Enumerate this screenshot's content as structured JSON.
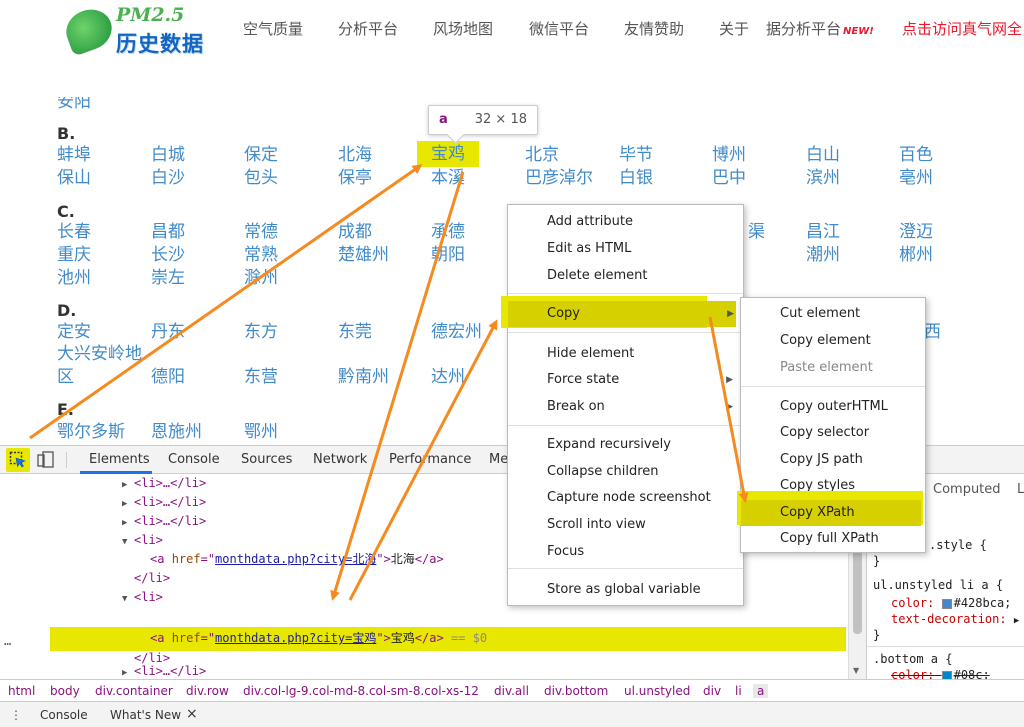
{
  "site": {
    "logo_top": "PM2.5",
    "logo_bottom": "历史数据",
    "nav": [
      "空气质量",
      "分析平台",
      "风场地图",
      "微信平台",
      "友情赞助",
      "关于"
    ],
    "nav_highlight_1": "据分析平台",
    "nav_new_badge": "NEW!",
    "nav_highlight_2": "点击访问真气网全"
  },
  "cities": {
    "partial_top": "安阳",
    "B": {
      "letter": "B.",
      "row1": [
        "蚌埠",
        "白城",
        "保定",
        "北海",
        "宝鸡",
        "北京",
        "毕节",
        "博州",
        "白山",
        "百色"
      ],
      "row2": [
        "保山",
        "白沙",
        "包头",
        "保亭",
        "本溪",
        "巴彦淖尔",
        "白银",
        "巴中",
        "滨州",
        "亳州"
      ]
    },
    "C": {
      "letter": "C.",
      "row1": [
        "长春",
        "昌都",
        "常德",
        "成都",
        "承德",
        "渠",
        "昌江",
        "澄迈"
      ],
      "row2": [
        "重庆",
        "长沙",
        "常熟",
        "楚雄州",
        "朝阳",
        "潮州",
        "郴州"
      ],
      "row3": [
        "池州",
        "崇左",
        "滁州"
      ]
    },
    "D": {
      "letter": "D.",
      "row1": [
        "定安",
        "丹东",
        "东方",
        "东莞",
        "德宏州",
        "西"
      ],
      "row2": [
        "大兴安岭地",
        "区",
        "德阳",
        "东营",
        "黔南州",
        "达州"
      ]
    },
    "E": {
      "letter": "E.",
      "row1": [
        "鄂尔多斯",
        "恩施州",
        "鄂州"
      ]
    }
  },
  "tooltip": {
    "tag": "a",
    "size": "32 × 18"
  },
  "devtools": {
    "tabs": [
      "Elements",
      "Console",
      "Sources",
      "Network",
      "Performance",
      "Me"
    ],
    "computed_tab": "Computed",
    "computed_tab_more": "L",
    "dom": {
      "lines": [
        {
          "tri": "▶",
          "text": "<li>…</li>"
        },
        {
          "tri": "▶",
          "text": "<li>…</li>"
        },
        {
          "tri": "▶",
          "text": "<li>…</li>"
        },
        {
          "tri": "▼",
          "text": "<li>"
        },
        {
          "tri": "",
          "text": "</li>"
        },
        {
          "tri": "▼",
          "text": "<li>"
        },
        {
          "tri": "",
          "text": "</li>"
        },
        {
          "tri": "▶",
          "text": "<li>…</li>"
        },
        {
          "tri": "▶",
          "text": "<li>…</li>"
        }
      ],
      "a1": {
        "open": "<a ",
        "attr": "href",
        "eq": "=\"",
        "val": "monthdata.php?city=北海",
        "close": "\">",
        "text": "北海",
        "end": "</a>"
      },
      "a2": {
        "open": "<a ",
        "attr": "href",
        "eq": "=\"",
        "val": "monthdata.php?city=宝鸡",
        "close": "\">",
        "text": "宝鸡",
        "end": "</a>",
        "marker": "== $0"
      },
      "ellipsis": "…"
    },
    "styles": {
      "line1": ".style {",
      "line2": "}",
      "rule1_selector": "ul.unstyled li a {",
      "rule1_p1_name": "color:",
      "rule1_p1_value": "#428bca;",
      "rule1_p1_color": "#428bca",
      "rule1_p2_name": "text-decoration:",
      "rule1_p2_value": "▶",
      "rule1_close": "}",
      "rule2_selector": ".bottom a {",
      "rule2_p1_name": "color:",
      "rule2_p1_value": "#08c;",
      "rule2_p1_color": "#0088cc"
    },
    "breadcrumb": [
      "html",
      "body",
      "div.container",
      "div.row",
      "div.col-lg-9.col-md-8.col-sm-8.col-xs-12",
      "div.all",
      "div.bottom",
      "ul.unstyled",
      "div",
      "li",
      "a"
    ],
    "drawer": {
      "console": "Console",
      "whats_new": "What's New",
      "close": "×"
    }
  },
  "context_menu": {
    "items": [
      "Add attribute",
      "Edit as HTML",
      "Delete element",
      "Copy",
      "Hide element",
      "Force state",
      "Break on",
      "Expand recursively",
      "Collapse children",
      "Capture node screenshot",
      "Scroll into view",
      "Focus",
      "Store as global variable"
    ]
  },
  "copy_submenu": {
    "items": [
      "Cut element",
      "Copy element",
      "Paste element",
      "Copy outerHTML",
      "Copy selector",
      "Copy JS path",
      "Copy styles",
      "Copy XPath",
      "Copy full XPath"
    ]
  },
  "colors": {
    "link": "#428bca",
    "annotation_yellow": "#e7e700",
    "arrow_orange": "#f58a1f"
  }
}
